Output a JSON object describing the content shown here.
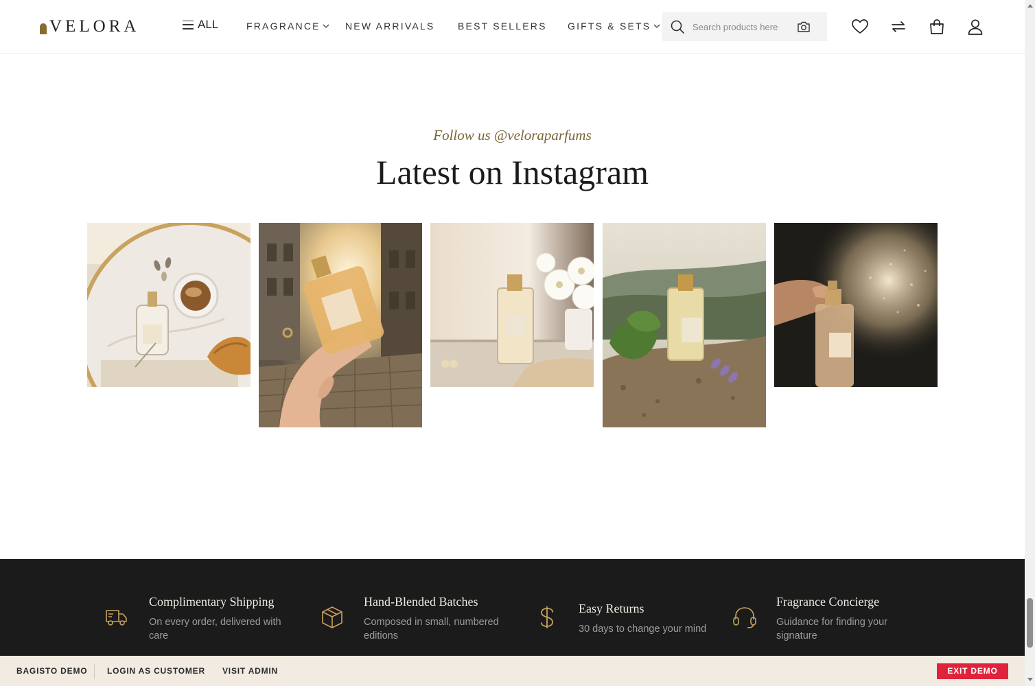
{
  "header": {
    "logo_text": "VELORA",
    "all_label": "ALL",
    "nav": [
      {
        "label": "FRAGRANCE",
        "has_dropdown": true
      },
      {
        "label": "NEW ARRIVALS",
        "has_dropdown": false
      },
      {
        "label": "BEST SELLERS",
        "has_dropdown": false
      },
      {
        "label": "GIFTS & SETS",
        "has_dropdown": true
      }
    ],
    "search_placeholder": "Search products here",
    "icons": [
      "search-icon",
      "camera-icon",
      "heart-icon",
      "compare-icon",
      "bag-icon",
      "user-icon"
    ]
  },
  "instagram": {
    "follow_text": "Follow us @veloraparfums",
    "title": "Latest on Instagram",
    "tiles": [
      "perfume-with-coffee-and-croissant",
      "perfume-in-hand-on-cobblestone-street",
      "perfume-with-white-flowers-on-vanity",
      "perfume-on-stone-with-fig-leaves-and-lavender",
      "hand-spraying-perfume-mist"
    ]
  },
  "features": [
    {
      "icon": "truck-icon",
      "title": "Complimentary Shipping",
      "subtitle": "On every order, delivered with care"
    },
    {
      "icon": "box-icon",
      "title": "Hand-Blended Batches",
      "subtitle": "Composed in small, numbered editions"
    },
    {
      "icon": "dollar-icon",
      "title": "Easy Returns",
      "subtitle": "30 days to change your mind"
    },
    {
      "icon": "headset-icon",
      "title": "Fragrance Concierge",
      "subtitle": "Guidance for finding your signature"
    }
  ],
  "demo_bar": {
    "brand": "BAGISTO DEMO",
    "login": "LOGIN AS CUSTOMER",
    "admin": "VISIT ADMIN",
    "exit": "EXIT DEMO"
  },
  "colors": {
    "gold_accent": "#8a6b32",
    "dark_band": "#1b1b1b",
    "demo_bar": "#f1ebe1",
    "exit_red": "#e0233c"
  }
}
